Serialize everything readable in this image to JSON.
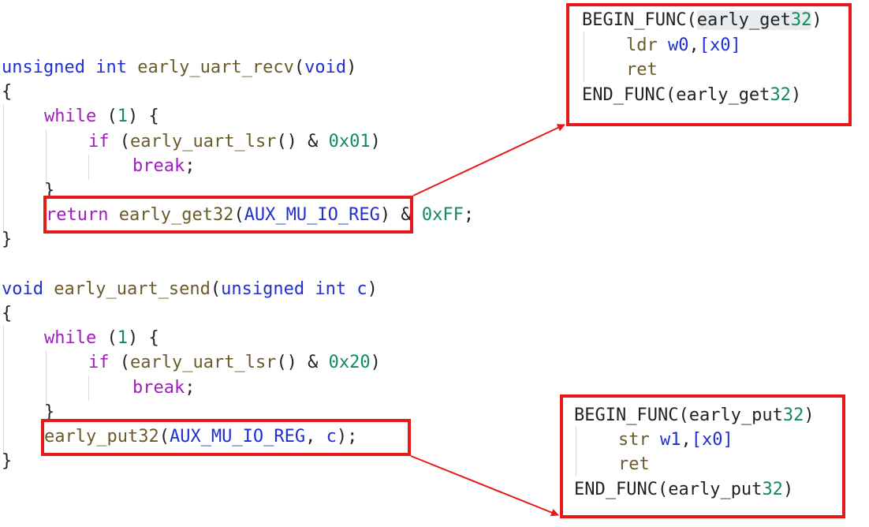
{
  "recv": {
    "sig_type": "unsigned int",
    "sig_name": "early_uart_recv",
    "sig_param": "void",
    "open_brace": "{",
    "while_kw": "while",
    "while_cond": "1",
    "if_kw": "if",
    "if_fn": "early_uart_lsr",
    "if_mask": "0x01",
    "break_kw": "break",
    "close_inner": "}",
    "return_kw": "return",
    "call_fn": "early_get32",
    "call_arg": "AUX_MU_IO_REG",
    "mask": "0xFF",
    "close_brace": "}"
  },
  "send": {
    "sig_type": "void",
    "sig_name": "early_uart_send",
    "sig_param_type": "unsigned int",
    "sig_param_name": "c",
    "open_brace": "{",
    "while_kw": "while",
    "while_cond": "1",
    "if_kw": "if",
    "if_fn": "early_uart_lsr",
    "if_mask": "0x20",
    "break_kw": "break",
    "close_inner": "}",
    "call_fn": "early_put32",
    "call_arg": "AUX_MU_IO_REG",
    "call_arg2": "c",
    "close_brace": "}"
  },
  "asm_get": {
    "begin": "BEGIN_FUNC",
    "name_prefix": "early_get",
    "name_num": "32",
    "instr1_op": "ldr",
    "instr1_reg": "w0",
    "instr1_mem": "[x0]",
    "instr2_op": "ret",
    "end": "END_FUNC"
  },
  "asm_put": {
    "begin": "BEGIN_FUNC",
    "name_prefix": "early_put",
    "name_num": "32",
    "instr1_op": "str",
    "instr1_reg": "w1",
    "instr1_mem": "[x0]",
    "instr2_op": "ret",
    "end": "END_FUNC"
  },
  "colors": {
    "highlight_box": "#e8191b",
    "keyword": "#1f2fd0",
    "control": "#a11bc0",
    "function": "#6b5a2a",
    "number": "#128a5e"
  }
}
